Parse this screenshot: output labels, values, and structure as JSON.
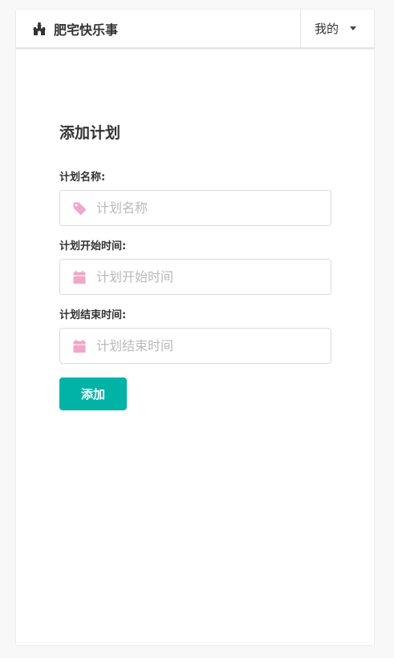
{
  "navbar": {
    "brand_text": "肥宅快乐事",
    "brand_icon": "castle-icon",
    "user_menu_label": "我的",
    "user_menu_icon": "caret-down-icon"
  },
  "form": {
    "title": "添加计划",
    "fields": [
      {
        "label": "计划名称:",
        "placeholder": "计划名称",
        "value": "",
        "icon": "tag-icon"
      },
      {
        "label": "计划开始时间:",
        "placeholder": "计划开始时间",
        "value": "",
        "icon": "calendar-icon"
      },
      {
        "label": "计划结束时间:",
        "placeholder": "计划结束时间",
        "value": "",
        "icon": "calendar-icon"
      }
    ],
    "submit_label": "添加"
  },
  "colors": {
    "accent": "#00b3a6",
    "icon_pink": "#f0a7c8",
    "placeholder": "#b9b9b9",
    "border": "#dbdbdb"
  }
}
